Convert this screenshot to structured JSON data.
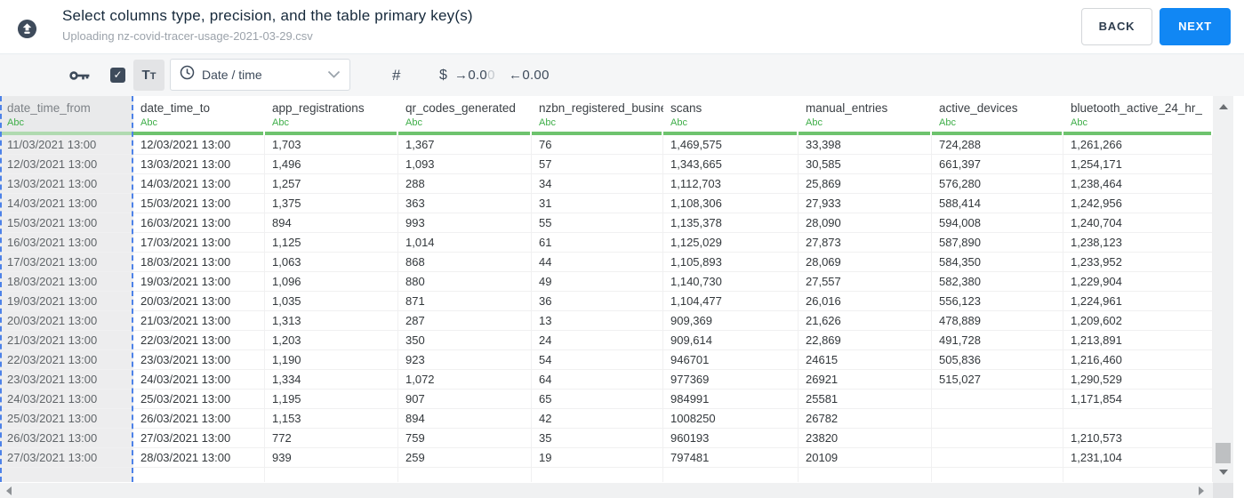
{
  "header": {
    "title": "Select columns type, precision, and the table primary key(s)",
    "subtitle": "Uploading nz-covid-tracer-usage-2021-03-29.csv",
    "back_label": "BACK",
    "next_label": "NEXT"
  },
  "toolbar": {
    "checkbox_checked": "✓",
    "text_type_big": "T",
    "text_type_small": "T",
    "type_selector_value": "Date / time",
    "hash_label": "#",
    "currency_label": "$",
    "decimal_increase": {
      "arrow": "→",
      "dark": "0.0",
      "faded": "0"
    },
    "decimal_decrease": {
      "arrow": "←",
      "text": "0.00"
    }
  },
  "table": {
    "selected_column_index": 0,
    "columns": [
      {
        "name": "date_time_from",
        "type": "Abc"
      },
      {
        "name": "date_time_to",
        "type": "Abc"
      },
      {
        "name": "app_registrations",
        "type": "Abc"
      },
      {
        "name": "qr_codes_generated",
        "type": "Abc"
      },
      {
        "name": "nzbn_registered_busine",
        "type": "Abc"
      },
      {
        "name": "scans",
        "type": "Abc"
      },
      {
        "name": "manual_entries",
        "type": "Abc"
      },
      {
        "name": "active_devices",
        "type": "Abc"
      },
      {
        "name": "bluetooth_active_24_hr_",
        "type": "Abc"
      }
    ],
    "rows": [
      [
        "11/03/2021 13:00",
        "12/03/2021 13:00",
        "1,703",
        "1,367",
        "76",
        "1,469,575",
        "33,398",
        "724,288",
        "1,261,266"
      ],
      [
        "12/03/2021 13:00",
        "13/03/2021 13:00",
        "1,496",
        "1,093",
        "57",
        "1,343,665",
        "30,585",
        "661,397",
        "1,254,171"
      ],
      [
        "13/03/2021 13:00",
        "14/03/2021 13:00",
        "1,257",
        "288",
        "34",
        "1,112,703",
        "25,869",
        "576,280",
        "1,238,464"
      ],
      [
        "14/03/2021 13:00",
        "15/03/2021 13:00",
        "1,375",
        "363",
        "31",
        "1,108,306",
        "27,933",
        "588,414",
        "1,242,956"
      ],
      [
        "15/03/2021 13:00",
        "16/03/2021 13:00",
        "894",
        "993",
        "55",
        "1,135,378",
        "28,090",
        "594,008",
        "1,240,704"
      ],
      [
        "16/03/2021 13:00",
        "17/03/2021 13:00",
        "1,125",
        "1,014",
        "61",
        "1,125,029",
        "27,873",
        "587,890",
        "1,238,123"
      ],
      [
        "17/03/2021 13:00",
        "18/03/2021 13:00",
        "1,063",
        "868",
        "44",
        "1,105,893",
        "28,069",
        "584,350",
        "1,233,952"
      ],
      [
        "18/03/2021 13:00",
        "19/03/2021 13:00",
        "1,096",
        "880",
        "49",
        "1,140,730",
        "27,557",
        "582,380",
        "1,229,904"
      ],
      [
        "19/03/2021 13:00",
        "20/03/2021 13:00",
        "1,035",
        "871",
        "36",
        "1,104,477",
        "26,016",
        "556,123",
        "1,224,961"
      ],
      [
        "20/03/2021 13:00",
        "21/03/2021 13:00",
        "1,313",
        "287",
        "13",
        "909,369",
        "21,626",
        "478,889",
        "1,209,602"
      ],
      [
        "21/03/2021 13:00",
        "22/03/2021 13:00",
        "1,203",
        "350",
        "24",
        "909,614",
        "22,869",
        "491,728",
        "1,213,891"
      ],
      [
        "22/03/2021 13:00",
        "23/03/2021 13:00",
        "1,190",
        "923",
        "54",
        "946701",
        "24615",
        "505,836",
        "1,216,460"
      ],
      [
        "23/03/2021 13:00",
        "24/03/2021 13:00",
        "1,334",
        "1,072",
        "64",
        "977369",
        "26921",
        "515,027",
        "1,290,529"
      ],
      [
        "24/03/2021 13:00",
        "25/03/2021 13:00",
        "1,195",
        "907",
        "65",
        "984991",
        "25581",
        "",
        "1,171,854"
      ],
      [
        "25/03/2021 13:00",
        "26/03/2021 13:00",
        "1,153",
        "894",
        "42",
        "1008250",
        "26782",
        "",
        ""
      ],
      [
        "26/03/2021 13:00",
        "27/03/2021 13:00",
        "772",
        "759",
        "35",
        "960193",
        "23820",
        "",
        "1,210,573"
      ],
      [
        "27/03/2021 13:00",
        "28/03/2021 13:00",
        "939",
        "259",
        "19",
        "797481",
        "20109",
        "",
        "1,231,104"
      ]
    ]
  },
  "colors": {
    "accent_blue": "#1187f4",
    "dark_slate": "#3e4b5b",
    "type_green": "#3fae49",
    "bar_green": "#6ec36e",
    "bar_green_selected": "#b0dab0",
    "selection_dash_blue": "#4d82e8"
  }
}
